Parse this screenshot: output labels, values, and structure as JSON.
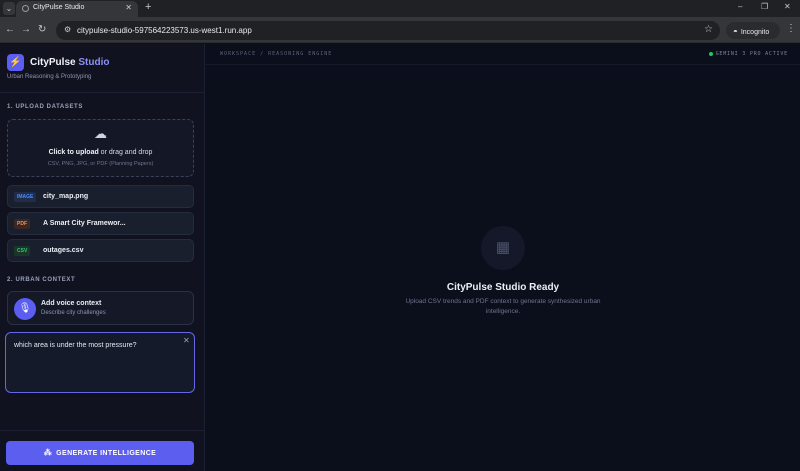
{
  "browser": {
    "tab_title": "CityPulse Studio",
    "tab_close": "✕",
    "new_tab": "+",
    "tab_list": "⌄",
    "url": "citypulse-studio-597564223573.us-west1.run.app",
    "incognito_label": "Incognito",
    "window_controls": [
      "–",
      "❐",
      "✕"
    ]
  },
  "brand": {
    "name": "CityPulse",
    "name_accent": "Studio",
    "subtitle": "Urban Reasoning & Prototyping"
  },
  "upload": {
    "section_title": "1. UPLOAD DATASETS",
    "cta_bold": "Click to upload",
    "cta_rest": " or drag and drop",
    "formats": "CSV, PNG, JPG, or PDF (Planning Papers)"
  },
  "files": [
    {
      "tag": "IMAGE",
      "name": "city_map.png",
      "tag_color": "#4b8df8",
      "tag_bg": "#1f2d4a"
    },
    {
      "tag": "PDF",
      "name": "A Smart City Framewor...",
      "tag_color": "#f0925a",
      "tag_bg": "#3b2723"
    },
    {
      "tag": "CSV",
      "name": "outages.csv",
      "tag_color": "#37c877",
      "tag_bg": "#1a3628"
    }
  ],
  "context": {
    "section_title": "2. URBAN CONTEXT",
    "voice_title": "Add voice context",
    "voice_sub": "Describe city challenges",
    "prompt_value": "which area is under the most pressure?"
  },
  "generate_label": "GENERATE INTELLIGENCE",
  "main": {
    "breadcrumb": "WORKSPACE / REASONING ENGINE",
    "status": "GEMINI 3 PRO ACTIVE",
    "empty_title": "CityPulse Studio Ready",
    "empty_desc": "Upload CSV trends and PDF context to generate synthesized urban intelligence."
  },
  "colors": {
    "accent": "#5c5ef0",
    "status_dot": "#22c55e"
  }
}
